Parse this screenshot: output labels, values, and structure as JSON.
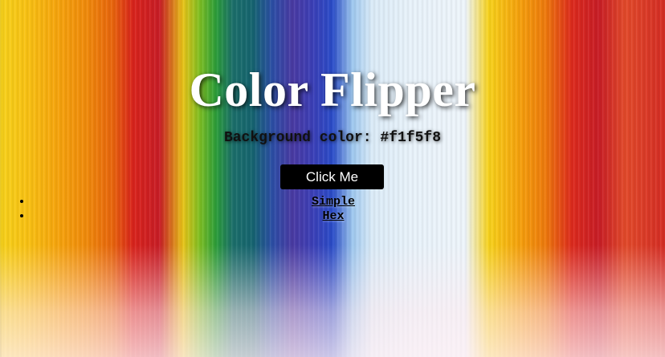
{
  "page": {
    "title": "Color Flipper",
    "background_label": "Background color:",
    "background_value": "#f1f5f8",
    "button_label": "Click Me",
    "nav_links": [
      "Simple",
      "Hex"
    ]
  }
}
